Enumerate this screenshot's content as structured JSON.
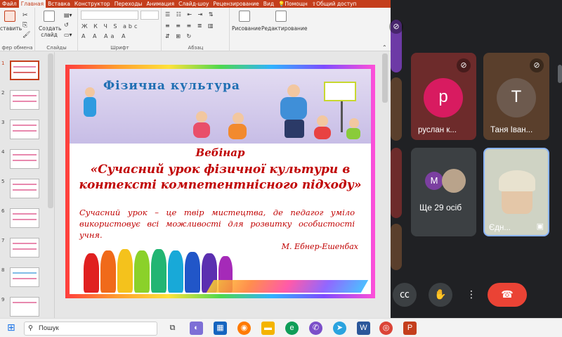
{
  "ribbon_tabs": [
    "Файл",
    "Главная",
    "Вставка",
    "Конструктор",
    "Переходы",
    "Анимация",
    "Слайд-шоу",
    "Рецензирование",
    "Вид",
    "Помощн",
    "Общий доступ"
  ],
  "ribbon": {
    "paste_label": "ставить",
    "clipboard_label": "фер обмена",
    "new_slide_label": "Создать слайд",
    "slides_label": "Слайды",
    "font_label": "Шрифт",
    "paragraph_label": "Абзац",
    "drawing_label": "Рисование",
    "editing_label": "Редактирование",
    "font_format_glyphs": "Ж К Ч S abc",
    "font_size_glyphs": "A A Aa A"
  },
  "thumbnails": [
    {
      "number": "1"
    },
    {
      "number": "2"
    },
    {
      "number": "3"
    },
    {
      "number": "4"
    },
    {
      "number": "5"
    },
    {
      "number": "6"
    },
    {
      "number": "7"
    },
    {
      "number": "8"
    },
    {
      "number": "9"
    }
  ],
  "slide": {
    "banner_title": "Фізична культура",
    "heading": "Вебінар",
    "title": "«Сучасний урок фізичної культури в контексті компетентнісного підходу»",
    "quote": "Сучасний урок – це твір мистецтва, де педагог уміло використовує всі можливості для розвитку особистості учня.",
    "author": "М. Ебнер-Ешенбах"
  },
  "meet": {
    "participants": [
      {
        "initial": "р",
        "name": "руслан к...",
        "color": "#d81b60"
      },
      {
        "initial": "Т",
        "name": "Таня Іван...",
        "color": "#6d5a4e"
      }
    ],
    "others_label": "Ще 29 осіб",
    "others_initial": "M",
    "others_color": "#7b3fa0",
    "self_label": "Єдн..."
  },
  "taskbar": {
    "search_placeholder": "Пошук"
  }
}
